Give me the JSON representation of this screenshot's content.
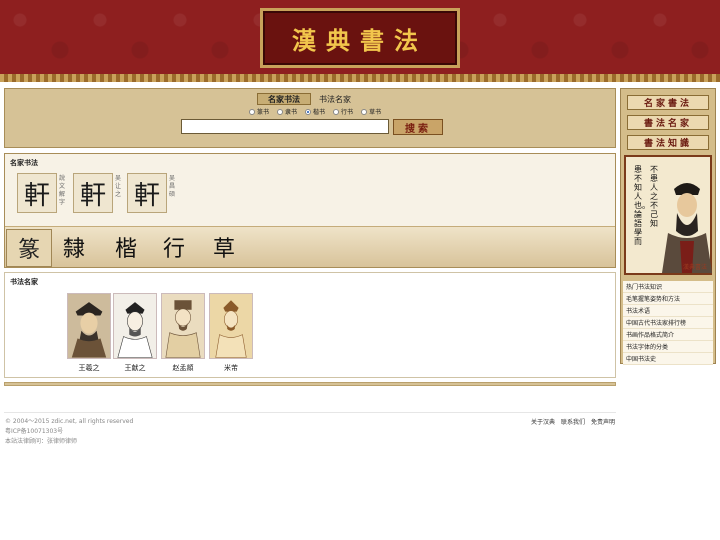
{
  "header": {
    "logo_text": "漢典書法"
  },
  "search": {
    "tab_active": "名家书法",
    "tab_other": "书法名家",
    "radios": [
      {
        "label": "篆书",
        "checked": false
      },
      {
        "label": "隶书",
        "checked": false
      },
      {
        "label": "楷书",
        "checked": true
      },
      {
        "label": "行书",
        "checked": false
      },
      {
        "label": "草书",
        "checked": false
      }
    ],
    "input_value": "",
    "button_label": "搜索"
  },
  "calligraphy": {
    "title": "名家书法",
    "tiles": [
      {
        "glyph": "軒",
        "caption": "說文解字"
      },
      {
        "glyph": "軒",
        "caption": "吴让之"
      },
      {
        "glyph": "軒",
        "caption": "吴昌硕"
      }
    ],
    "styles": [
      "篆",
      "隸",
      "楷",
      "行",
      "草"
    ]
  },
  "masters": {
    "title": "书法名家",
    "people": [
      {
        "name": "王羲之"
      },
      {
        "name": "王献之"
      },
      {
        "name": "赵孟頫"
      },
      {
        "name": "米芾"
      }
    ]
  },
  "sidebar": {
    "buttons": [
      "名家書法",
      "書法名家",
      "書法知識"
    ],
    "quote_columns": [
      "不患人之不己知",
      "患不知人也。論語學而"
    ],
    "quote_signature": "漢典書法",
    "links": [
      "热门书法知识",
      "毛笔握笔姿势和方法",
      "书法术语",
      "中国古代书法家排行榜",
      "书画作品格式简介",
      "书法字体的分类",
      "中国书法史"
    ]
  },
  "footer": {
    "copyright": "© 2004～2015 zdic.net, all rights reserved",
    "icp": "粤ICP备10071303号",
    "legal": "本站法律顾问：张律师律师",
    "links": [
      "关于汉典",
      "联系我们",
      "免责声明"
    ]
  }
}
